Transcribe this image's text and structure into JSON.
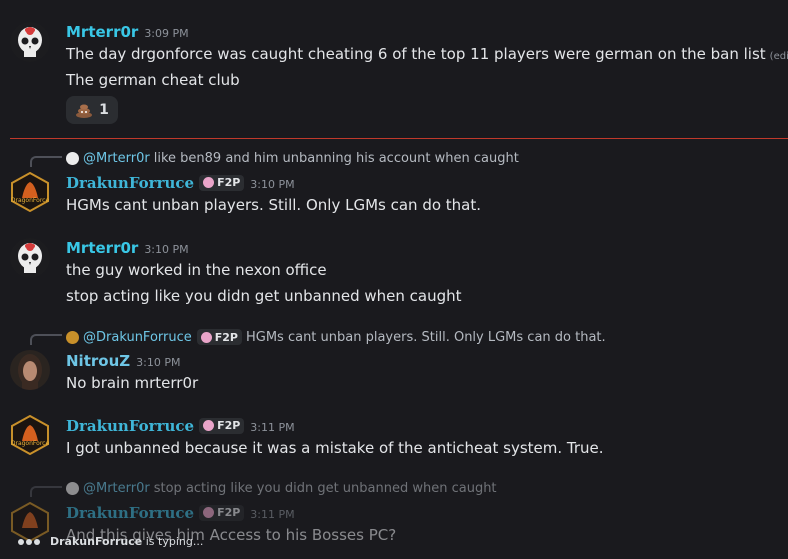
{
  "colors": {
    "cyan_name": "#39c7e6",
    "drakun_name": "#3fb6d8",
    "nitrou_name": "#6ec6e6",
    "divider": "#c0392b"
  },
  "messages": [
    {
      "author": "Mrterr0r",
      "time": "3:09 PM",
      "lines": [
        "The day drgonforce was caught cheating 6 of the top 11 players were german on the ban list",
        "The german cheat club"
      ],
      "edited": "(edited)",
      "reaction": {
        "icon": "poop-emoji",
        "count": "1"
      }
    },
    {
      "reply_to": "@Mrterr0r",
      "reply_text": "like ben89 and him unbanning his account when caught",
      "author": "DrakunForruce",
      "tag": "F2P",
      "time": "3:10 PM",
      "lines": [
        "HGMs cant unban players. Still. Only LGMs can do that."
      ]
    },
    {
      "author": "Mrterr0r",
      "time": "3:10 PM",
      "lines": [
        "the guy worked in the nexon office",
        "stop acting like you didn get unbanned when caught"
      ]
    },
    {
      "reply_to": "@DrakunForruce",
      "reply_tag": "F2P",
      "reply_text": "HGMs cant unban players. Still. Only LGMs can do that.",
      "author": "NitrouZ",
      "time": "3:10 PM",
      "lines": [
        "No brain mrterr0r"
      ]
    },
    {
      "author": "DrakunForruce",
      "tag": "F2P",
      "time": "3:11 PM",
      "lines": [
        "I got unbanned because it was a mistake of the anticheat system. True."
      ]
    },
    {
      "reply_to": "@Mrterr0r",
      "reply_text": "stop acting like you didn get unbanned when caught",
      "author": "DrakunForruce",
      "tag": "F2P",
      "time": "3:11 PM",
      "lines": [
        "And this gives him Access to his Bosses PC?"
      ]
    }
  ],
  "typing": {
    "user": "DrakunForruce",
    "text": "is typing..."
  }
}
